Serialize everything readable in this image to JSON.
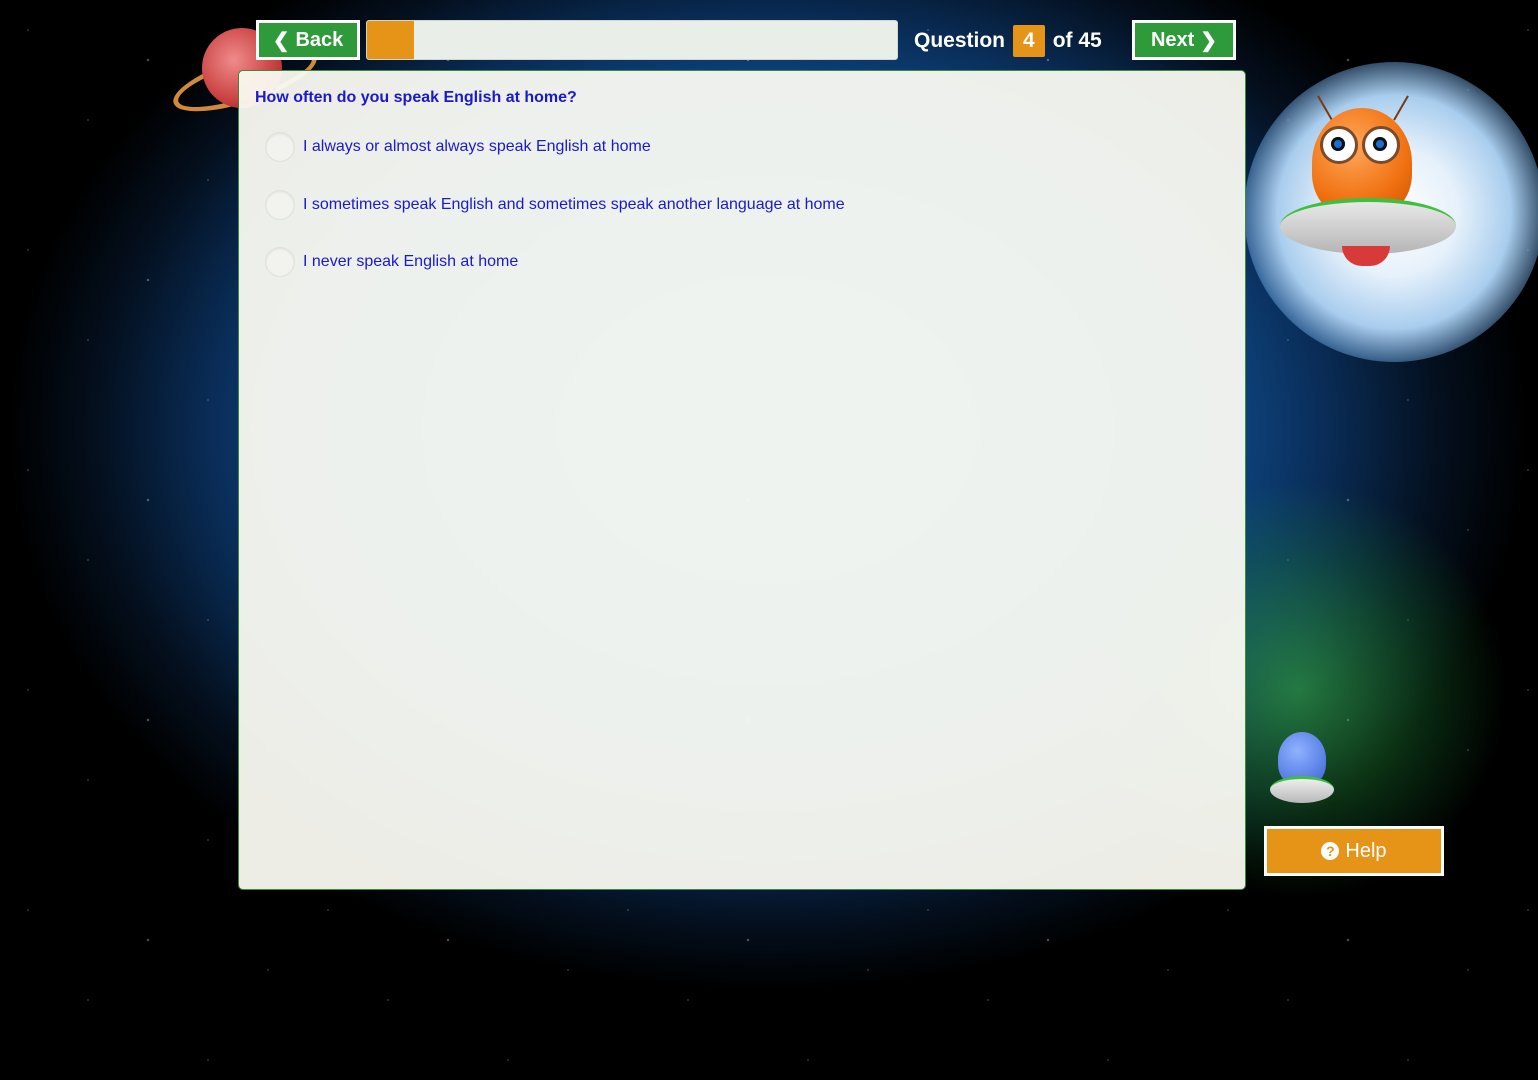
{
  "nav": {
    "back_label": "Back",
    "next_label": "Next"
  },
  "progress": {
    "question_word": "Question",
    "current": "4",
    "of_label": "of 45",
    "total": 45,
    "fraction_complete": 0.089
  },
  "question": {
    "text": "How often do you speak English at home?",
    "options": [
      {
        "label": "I always or almost always speak English at home",
        "selected": false
      },
      {
        "label": "I sometimes speak English and sometimes speak another language at home",
        "selected": false
      },
      {
        "label": "I never speak English at home",
        "selected": false
      }
    ]
  },
  "help": {
    "label": "Help",
    "icon": "question-circle-icon"
  },
  "colors": {
    "nav_green": "#2f9a3a",
    "accent_orange": "#e59418",
    "text_blue": "#1a1acb"
  }
}
